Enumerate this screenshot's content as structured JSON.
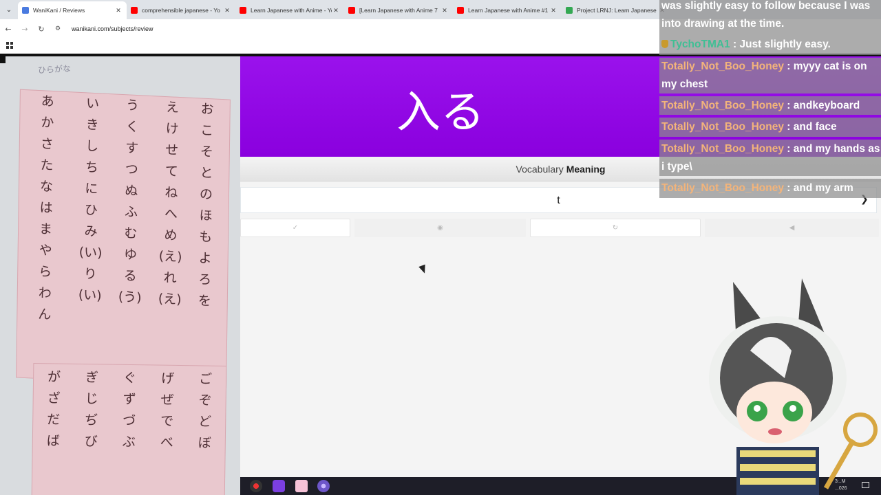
{
  "browser": {
    "tabs": [
      {
        "label": "WaniKani / Reviews",
        "active": true,
        "favicon_color": "#4a7be0"
      },
      {
        "label": "comprehensible japanese - Yo",
        "active": false,
        "favicon_color": "#ff0000"
      },
      {
        "label": "Learn Japanese with Anime - Yo",
        "active": false,
        "favicon_color": "#ff0000"
      },
      {
        "label": "[Learn Japanese with Anime 7",
        "active": false,
        "favicon_color": "#ff0000"
      },
      {
        "label": "Learn Japanese with Anime #1",
        "active": false,
        "favicon_color": "#ff0000"
      },
      {
        "label": "Project LRNJ: Learn Japanese K",
        "active": false,
        "favicon_color": "#34a853"
      }
    ],
    "tab_close_glyph": "✕",
    "url": "wanikani.com/subjects/review"
  },
  "review": {
    "character": "入る",
    "question_type": "Vocabulary",
    "question_category": "Meaning",
    "answer_value": "t",
    "submit_icon": "chevron-right-icon",
    "actions": [
      {
        "name": "checkmark-icon",
        "glyph": "✓"
      },
      {
        "name": "eye-icon",
        "glyph": "◉"
      },
      {
        "name": "undo-icon",
        "glyph": "↻"
      },
      {
        "name": "audio-icon",
        "glyph": "◀"
      }
    ]
  },
  "webcam": {
    "label": "ひらがな",
    "hiragana_top": [
      [
        "お",
        "こ",
        "そ",
        "と",
        "の",
        "ほ",
        "も",
        "よ",
        "ろ",
        "を"
      ],
      [
        "え",
        "け",
        "せ",
        "て",
        "ね",
        "へ",
        "め",
        "(え)",
        "れ",
        "(え)"
      ],
      [
        "う",
        "く",
        "す",
        "つ",
        "ぬ",
        "ふ",
        "む",
        "ゆ",
        "る",
        "(う)"
      ],
      [
        "い",
        "き",
        "し",
        "ち",
        "に",
        "ひ",
        "み",
        "(い)",
        "り",
        "(い)"
      ],
      [
        "あ",
        "か",
        "さ",
        "た",
        "な",
        "は",
        "ま",
        "や",
        "ら",
        "わ",
        "ん"
      ]
    ],
    "hiragana_bottom": [
      [
        "ご",
        "ぞ",
        "ど",
        "ぼ"
      ],
      [
        "げ",
        "ぜ",
        "で",
        "べ"
      ],
      [
        "ぐ",
        "ず",
        "づ",
        "ぶ"
      ],
      [
        "ぎ",
        "じ",
        "ぢ",
        "び"
      ],
      [
        "が",
        "ざ",
        "だ",
        "ば"
      ]
    ]
  },
  "chat": {
    "messages": [
      {
        "user": "",
        "text": "was slightly easy to follow because I was into drawing at the time."
      },
      {
        "user": "TychoTMA1",
        "text": " : Just slightly easy.",
        "badge": true
      },
      {
        "user": "Totally_Not_Boo_Honey",
        "text": " : myyy cat is on my chest"
      },
      {
        "user": "Totally_Not_Boo_Honey",
        "text": " : andkeyboard"
      },
      {
        "user": "Totally_Not_Boo_Honey",
        "text": " : and face"
      },
      {
        "user": "Totally_Not_Boo_Honey",
        "text": " : and my hands as i type\\"
      },
      {
        "user": "Totally_Not_Boo_Honey",
        "text": " : and my arm"
      }
    ]
  },
  "taskbar": {
    "clock_time": "3:..M",
    "clock_date": "...026"
  },
  "colors": {
    "wk_purple": "#9a12ec",
    "chat_username": "#f3b47a",
    "chat_username_alt": "#3fbf94"
  }
}
